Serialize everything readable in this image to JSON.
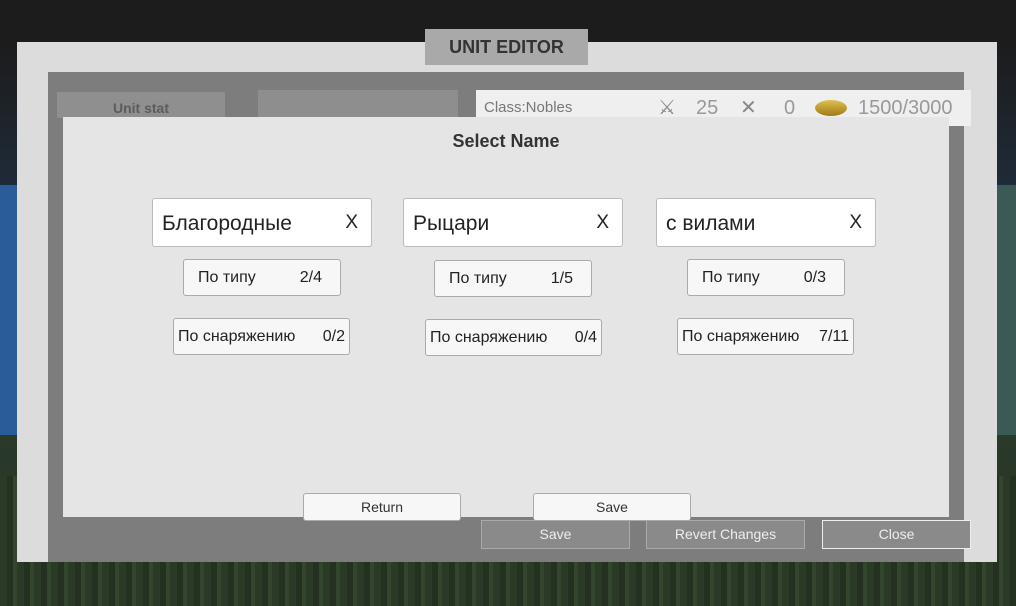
{
  "window_title": "UNIT EDITOR",
  "background": {
    "unit_stat_label": "Unit stat",
    "class_label": "Class:Nobles",
    "stats": [
      {
        "icon": "crossed-swords-icon",
        "value": "25"
      },
      {
        "icon": "crossed-bow-icon",
        "value": "0"
      },
      {
        "icon": "coins-icon",
        "value": "1500/3000"
      }
    ],
    "buttons": {
      "save": "Save",
      "revert": "Revert Changes",
      "close": "Close"
    }
  },
  "dialog": {
    "title": "Select Name",
    "columns": [
      {
        "name": "Благородные",
        "clear": "X",
        "type_label": "По типу",
        "type_count": "2/4",
        "equip_label": "По снаряжению",
        "equip_count": "0/2"
      },
      {
        "name": "Рыцари",
        "clear": "X",
        "type_label": "По типу",
        "type_count": "1/5",
        "equip_label": "По снаряжению",
        "equip_count": "0/4"
      },
      {
        "name": "с вилами",
        "clear": "X",
        "type_label": "По типу",
        "type_count": "0/3",
        "equip_label": "По снаряжению",
        "equip_count": "7/11"
      }
    ],
    "return_label": "Return",
    "save_label": "Save"
  }
}
